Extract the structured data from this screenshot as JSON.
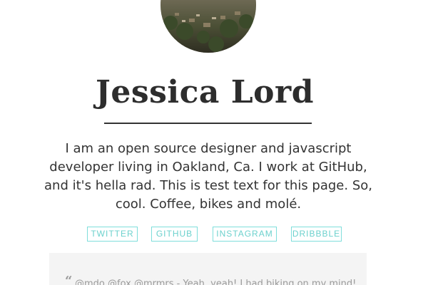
{
  "profile": {
    "avatar_icon": "profile-photo-icon",
    "name": "Jessica Lord",
    "bio": "I am an open source designer and javascript developer living in Oakland, Ca. I work at GitHub, and it's hella rad. This is test text for this page. So, cool. Coffee, bikes and molé."
  },
  "socials": [
    {
      "label": "TWITTER"
    },
    {
      "label": "GITHUB"
    },
    {
      "label": "INSTAGRAM"
    },
    {
      "label": "DRIBBBLE"
    }
  ],
  "tweet": {
    "quote_mark": "“",
    "text": "@mdo @fox @mrmrs - Yeah, yeah! I had biking on my mind!"
  },
  "colors": {
    "accent": "#6cd1cd",
    "text": "#333333",
    "card_background": "#f4f4f4"
  }
}
